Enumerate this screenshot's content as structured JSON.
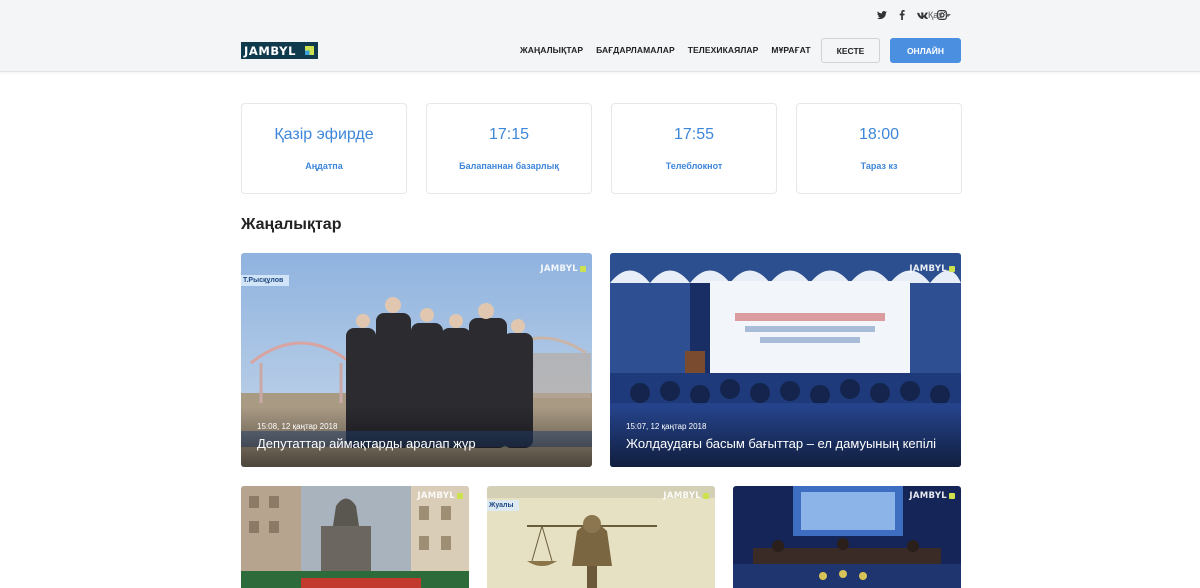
{
  "header": {
    "logo_text": "JAMBYL",
    "social": [
      {
        "name": "twitter-icon"
      },
      {
        "name": "facebook-icon"
      },
      {
        "name": "vk-icon"
      },
      {
        "name": "instagram-icon"
      }
    ],
    "language": "Қаз",
    "nav": [
      "ЖАҢАЛЫҚТАР",
      "БАҒДАРЛАМАЛАР",
      "ТЕЛЕХИКАЯЛАР",
      "МҰРАҒАТ"
    ],
    "schedule_button": "КЕСТЕ",
    "online_button": "ОНЛАЙН"
  },
  "schedule": [
    {
      "time": "Қазір эфирде",
      "program": "Аңдатпа"
    },
    {
      "time": "17:15",
      "program": "Балапаннан базарлық"
    },
    {
      "time": "17:55",
      "program": "Телеблокнот"
    },
    {
      "time": "18:00",
      "program": "Тараз кз"
    }
  ],
  "news": {
    "section_title": "Жаңалықтар",
    "featured": [
      {
        "date": "15:08, 12 қаңтар 2018",
        "title": "Депутаттар аймақтарды аралап жүр",
        "strip": "Т.Рысқұлов",
        "watermark": "JAMBYL"
      },
      {
        "date": "15:07, 12 қаңтар 2018",
        "title": "Жолдаудағы басым бағыттар – ел дамуының кепілі",
        "watermark": "JAMBYL"
      }
    ],
    "secondary": [
      {
        "watermark": "JAMBYL"
      },
      {
        "strip": "Жуалы",
        "watermark": "JAMBYL"
      },
      {
        "watermark": "JAMBYL"
      }
    ]
  },
  "colors": {
    "accent": "#4a8fe0",
    "link": "#3d86d9",
    "logo_bg": "#0f3b4d",
    "logo_mark": "#cde24f"
  }
}
